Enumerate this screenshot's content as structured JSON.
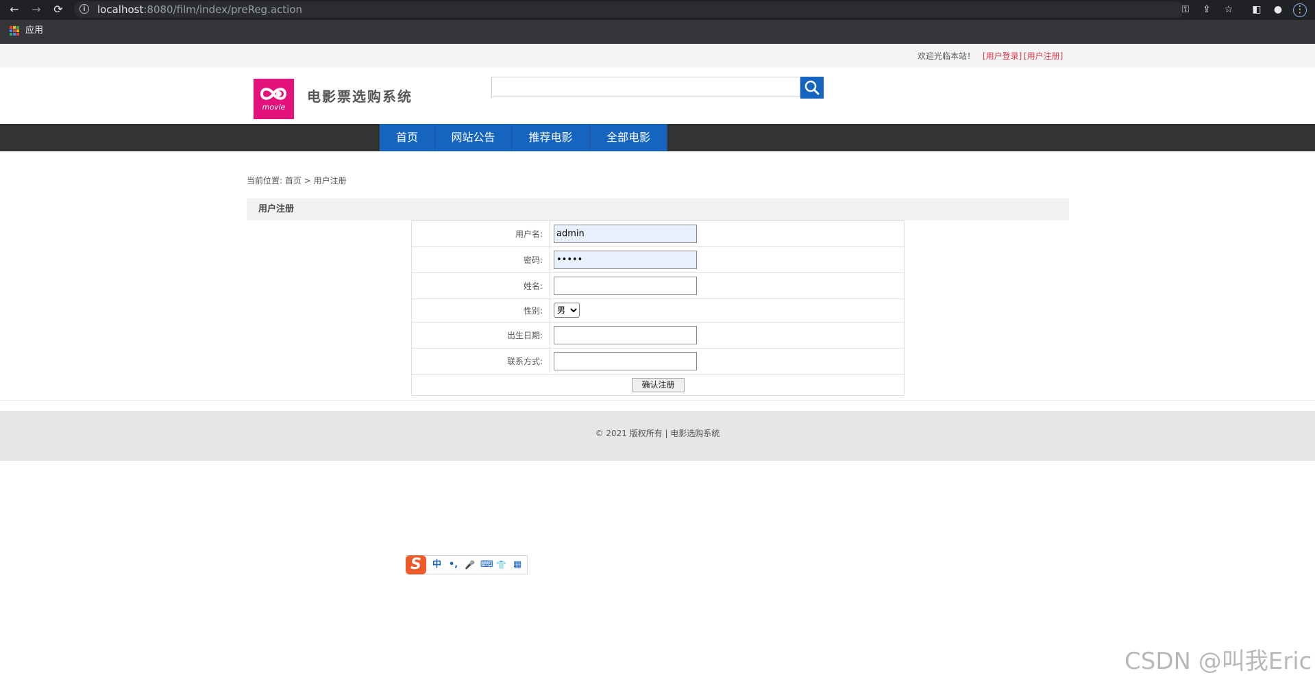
{
  "browser": {
    "url_host": "localhost",
    "url_rest": ":8080/film/index/preReg.action",
    "apps_label": "应用"
  },
  "site": {
    "welcome": "欢迎光临本站！",
    "login_link": "[用户登录]",
    "register_link": "[用户注册]",
    "logo_word": "movie",
    "title": "电影票选购系统",
    "search_value": "",
    "nav": [
      "首页",
      "网站公告",
      "推荐电影",
      "全部电影"
    ],
    "accent_color": "#1565c0",
    "logo_color": "#e4137c",
    "link_color": "#e0364a"
  },
  "breadcrumb": {
    "prefix": "当前位置:",
    "home": "首页",
    "separator": ">",
    "current": "用户注册"
  },
  "form": {
    "section_title": "用户注册",
    "username_label": "用户名:",
    "username_value": "admin",
    "password_label": "密码:",
    "password_value": "admin",
    "name_label": "姓名:",
    "name_value": "",
    "gender_label": "性别:",
    "gender_value": "男",
    "birthday_label": "出生日期:",
    "birthday_value": "",
    "contact_label": "联系方式:",
    "contact_value": "",
    "submit_label": "确认注册"
  },
  "footer": {
    "text": "© 2021 版权所有  |   电影选购系统"
  },
  "ime": {
    "items": [
      "中",
      "•,",
      "🎤",
      "⌨",
      "👕",
      "▦"
    ]
  },
  "watermark": "CSDN @叫我Eric"
}
